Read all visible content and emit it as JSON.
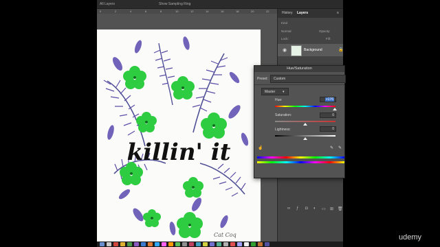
{
  "options_bar": {
    "sample_label": "All Layers",
    "toggle_label": "Show Sampling Ring"
  },
  "ruler": {
    "ticks": [
      "0",
      "2",
      "4",
      "6",
      "8",
      "10",
      "12",
      "14",
      "16",
      "18",
      "20",
      "22"
    ]
  },
  "artwork": {
    "text": "killin' it",
    "signature": "Cat Coq"
  },
  "right_panel": {
    "tabs": [
      "History",
      "Layers"
    ],
    "kind_label": "Kind",
    "normal_label": "Normal",
    "opacity_label": "Opacity:",
    "lock_label": "Lock:",
    "fill_label": "Fill:",
    "layer_name": "Background"
  },
  "hue_saturation": {
    "title": "Hue/Saturation",
    "preset_label": "Preset:",
    "preset_value": "Custom",
    "channel": "Master",
    "hue_label": "Hue:",
    "hue_value": "+176",
    "saturation_label": "Saturation:",
    "saturation_value": "0",
    "lightness_label": "Lightness:",
    "lightness_value": "0",
    "hue_level": 0.99,
    "saturation_level": 0.5,
    "lightness_level": 0.5
  },
  "watermark": "udemy",
  "colors": {
    "accent": "#3f73c8",
    "panel": "#535353",
    "leaf_green": "#2ecc40",
    "leaf_purple": "#4b3a9e"
  }
}
